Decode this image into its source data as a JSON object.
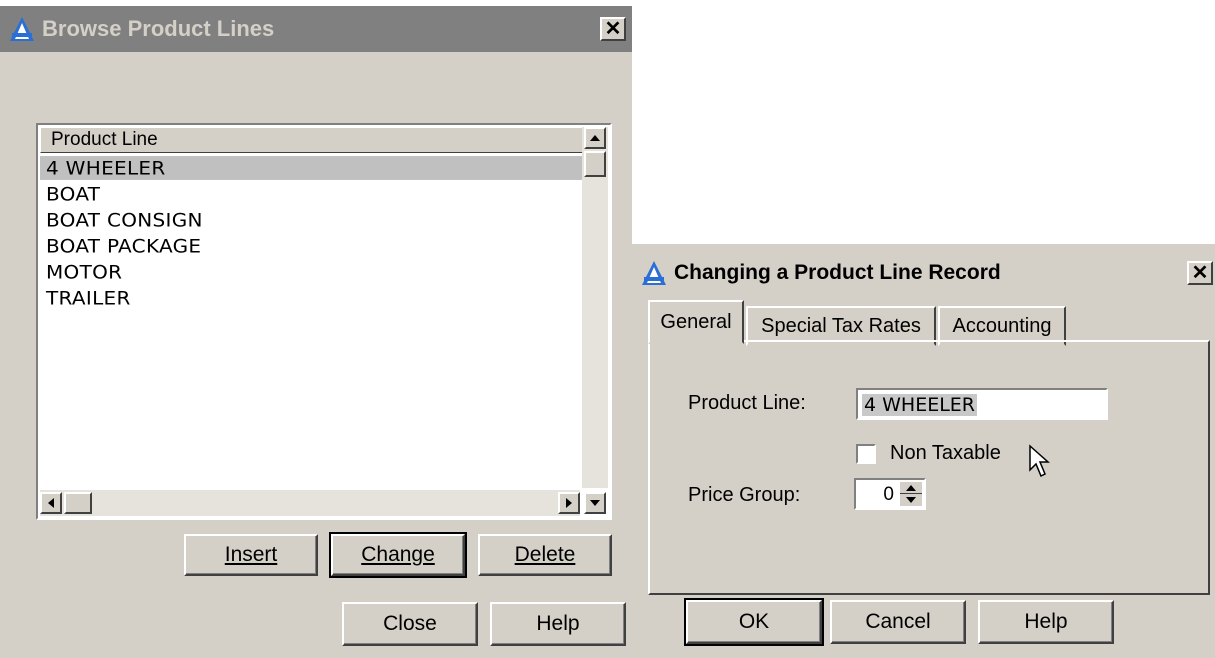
{
  "browse": {
    "title": "Browse Product Lines",
    "column_header": "Product Line",
    "items": [
      "4 WHEELER",
      "BOAT",
      "BOAT CONSIGN",
      "BOAT PACKAGE",
      "MOTOR",
      "TRAILER"
    ],
    "selected_item": "4 WHEELER",
    "buttons": {
      "insert": "Insert",
      "change": "Change",
      "delete": "Delete",
      "close": "Close",
      "help": "Help"
    }
  },
  "change_dialog": {
    "title": "Changing a Product Line  Record",
    "tabs": [
      "General",
      "Special Tax Rates",
      "Accounting"
    ],
    "active_tab": "General",
    "fields": {
      "product_line_label": "Product Line:",
      "product_line_value": "4 WHEELER",
      "non_taxable_label": "Non Taxable",
      "non_taxable_checked": false,
      "price_group_label": "Price Group:",
      "price_group_value": "0"
    },
    "buttons": {
      "ok": "OK",
      "cancel": "Cancel",
      "help": "Help"
    }
  },
  "icons": {
    "app": "app-icon",
    "close": "close-icon",
    "cursor": "mouse-pointer-icon"
  },
  "colors": {
    "dialog_face": "#d4d0c8",
    "inactive_titlebar": "#808080",
    "title_text": "#d4d0c8",
    "selection": "#c0c0c0"
  }
}
